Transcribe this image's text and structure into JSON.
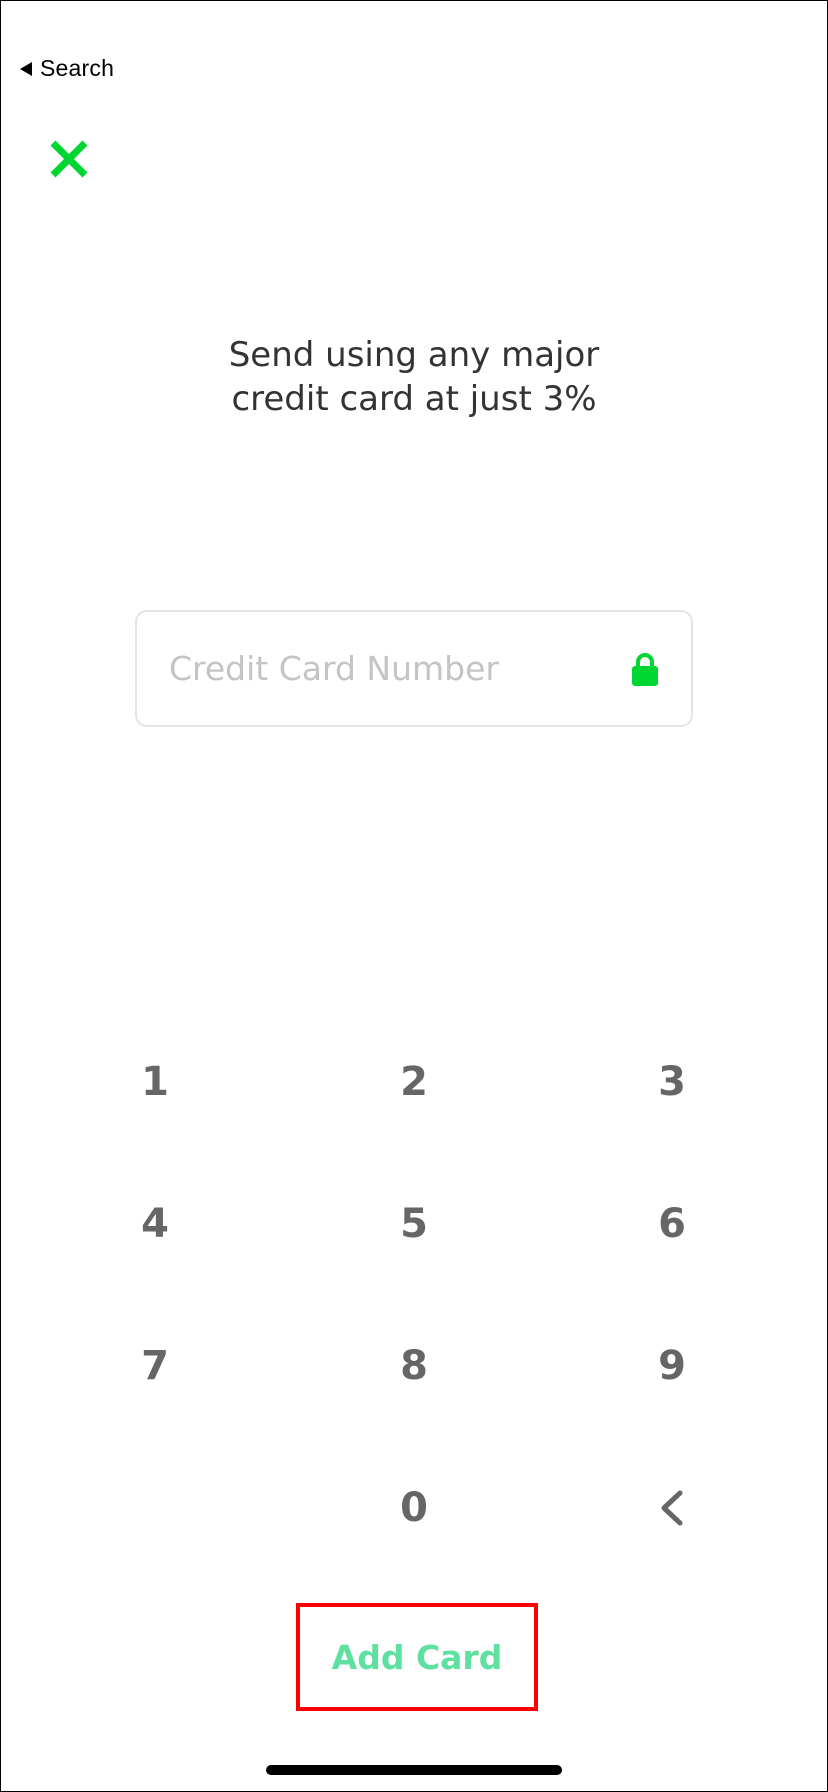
{
  "status_bar": {
    "back_label": "Search"
  },
  "header": {
    "close_icon": "close-x-icon",
    "close_color": "#00d632"
  },
  "main": {
    "headline_line1": "Send using any major",
    "headline_line2": "credit card at just 3%",
    "card_input": {
      "placeholder": "Credit Card Number",
      "value": "",
      "lock_icon": "lock-icon",
      "lock_color": "#00d632"
    }
  },
  "keypad": {
    "keys": [
      "1",
      "2",
      "3",
      "4",
      "5",
      "6",
      "7",
      "8",
      "9",
      "0"
    ],
    "backspace_icon": "chevron-left-icon"
  },
  "footer": {
    "add_card_label": "Add Card",
    "add_card_color": "#5ee0a0",
    "highlight_color": "#ff0000"
  }
}
